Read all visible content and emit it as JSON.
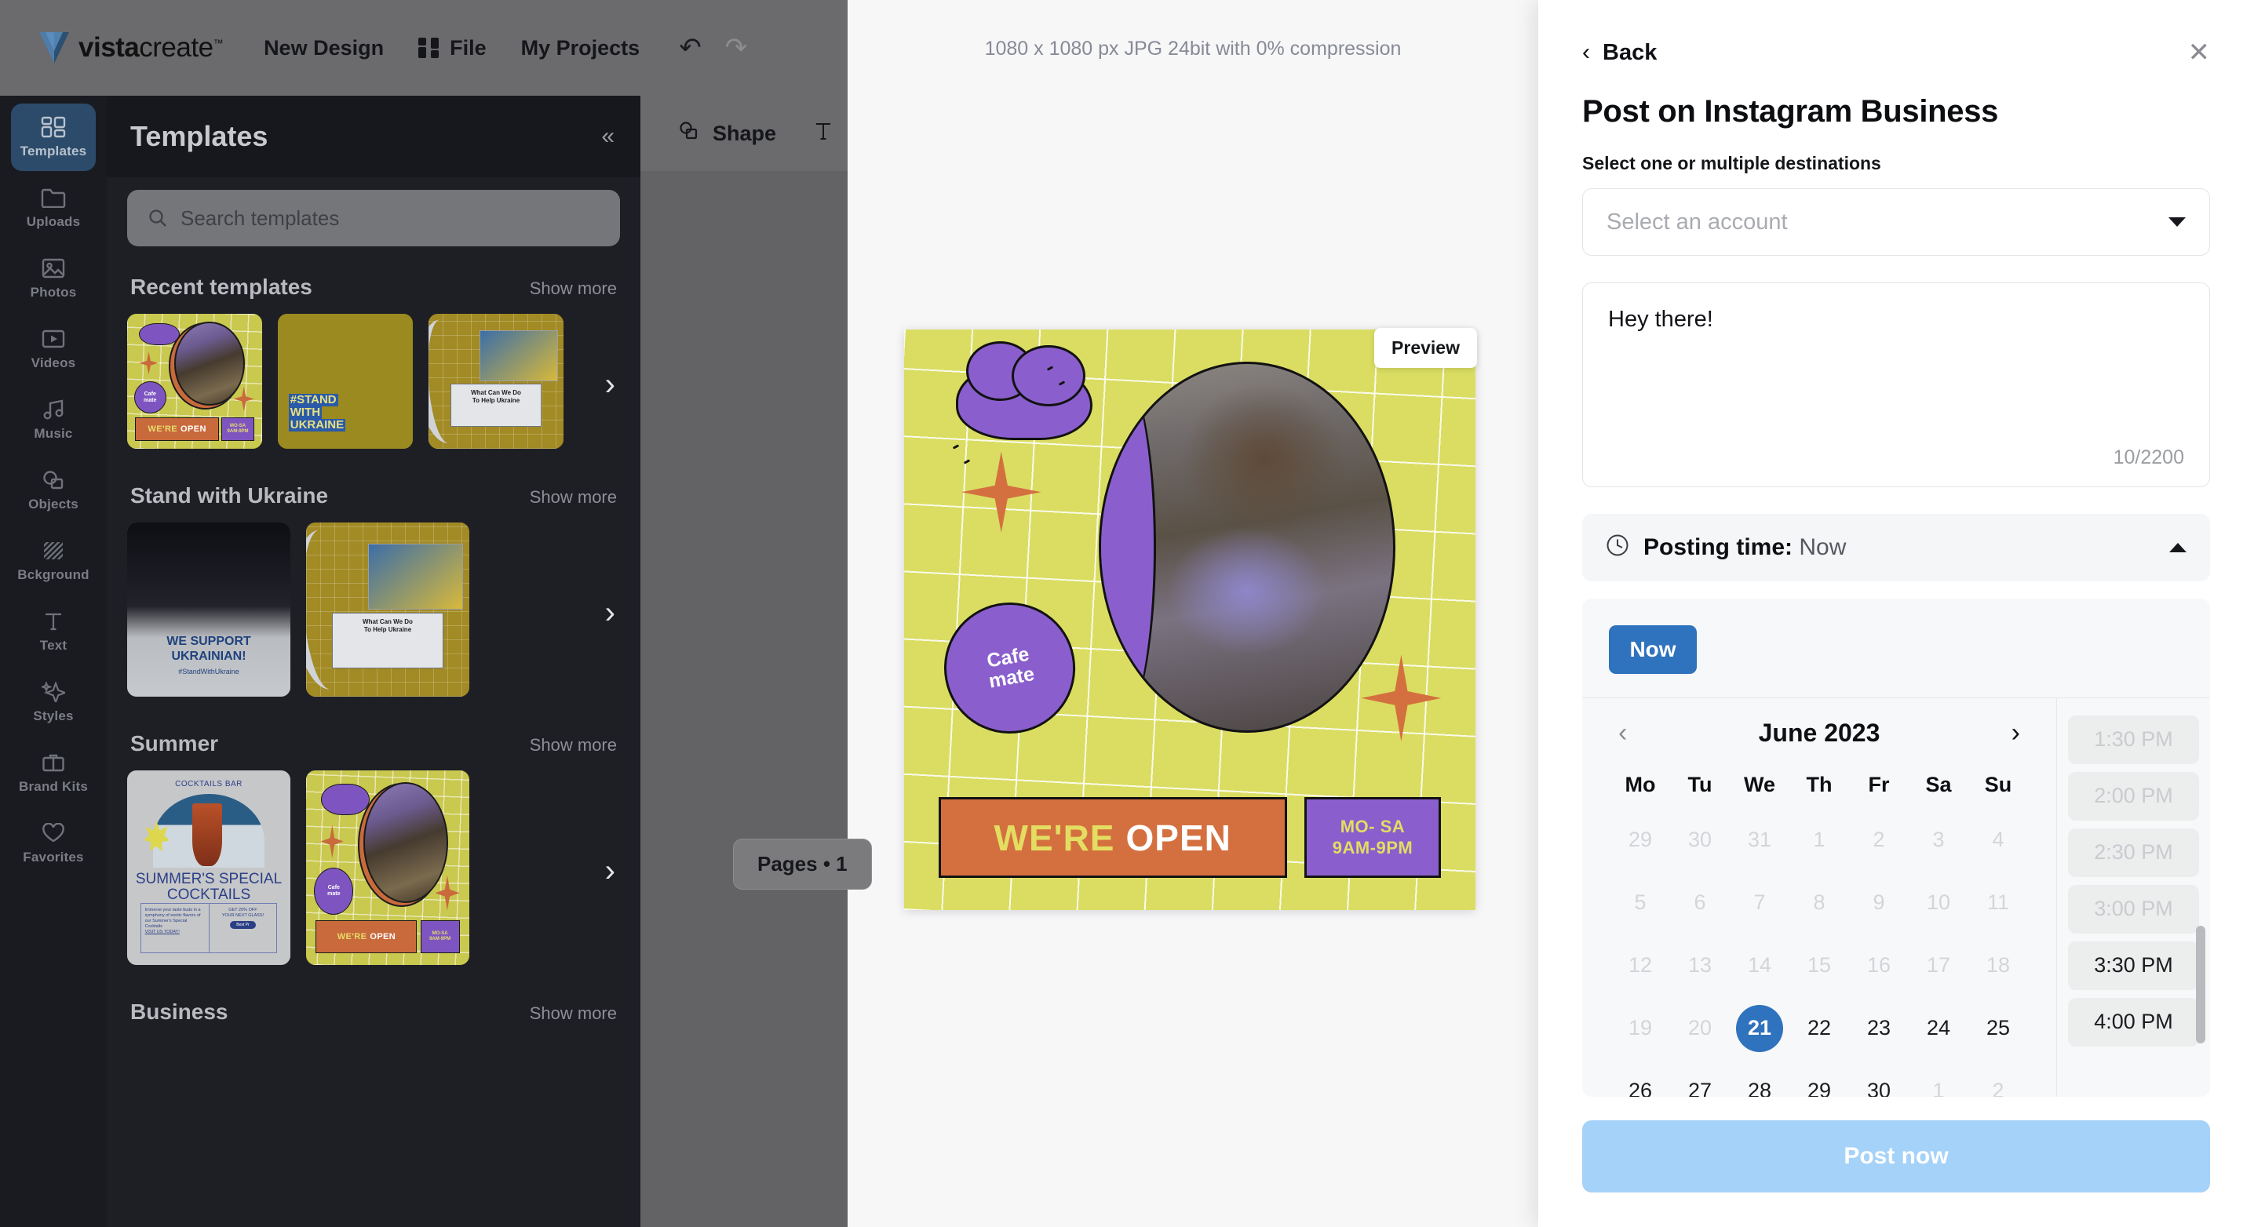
{
  "topbar": {
    "brand_bold": "vista",
    "brand_light": "create",
    "brand_tm": "TM",
    "new_design": "New Design",
    "file": "File",
    "my_projects": "My Projects",
    "undo_icon": "undo-arrow",
    "redo_icon": "redo-arrow"
  },
  "rail": {
    "items": [
      {
        "label": "Templates",
        "icon": "templates-grid-icon",
        "active": true
      },
      {
        "label": "Uploads",
        "icon": "folder-icon",
        "active": false
      },
      {
        "label": "Photos",
        "icon": "image-icon",
        "active": false
      },
      {
        "label": "Videos",
        "icon": "video-play-icon",
        "active": false
      },
      {
        "label": "Music",
        "icon": "music-note-icon",
        "active": false
      },
      {
        "label": "Objects",
        "icon": "shapes-icon",
        "active": false
      },
      {
        "label": "Bckground",
        "icon": "hatch-square-icon",
        "active": false
      },
      {
        "label": "Text",
        "icon": "text-t-icon",
        "active": false
      },
      {
        "label": "Styles",
        "icon": "sparkle-icon",
        "active": false
      },
      {
        "label": "Brand Kits",
        "icon": "briefcase-icon",
        "active": false
      },
      {
        "label": "Favorites",
        "icon": "heart-icon",
        "active": false
      }
    ]
  },
  "panel": {
    "title": "Templates",
    "collapse_icon": "collapse-left-icon",
    "search_placeholder": "Search templates",
    "search_icon": "search-icon",
    "sections": [
      {
        "title": "Recent templates",
        "more": "Show more"
      },
      {
        "title": "Stand with Ukraine",
        "more": "Show more"
      },
      {
        "title": "Summer",
        "more": "Show more"
      },
      {
        "title": "Business",
        "more": "Show more"
      }
    ],
    "thumb_texts": {
      "open_bubble": "Cafe\nmate",
      "open_band": "WE'RE",
      "open_band_b": "OPEN",
      "open_hours_1": "MO- SA",
      "open_hours_2": "9AM-9PM",
      "swu_l1": "#STAND",
      "swu_l2": "WITH",
      "swu_l3": "UKRAINE",
      "ukr_window": "What Can We Do To Help Ukraine",
      "support_main": "WE SUPPORT UKRAINIAN!",
      "support_sub": "#StandWithUkraine",
      "cocktail_kicker": "COCKTAILS BAR",
      "cocktail_title": "SUMMER'S SPECIAL COCKTAILS",
      "cocktail_body": "Immerse your taste buds in a symphony of exotic flavors of our Summer's Special Cocktails",
      "cocktail_link": "VISIT US TODAY!",
      "cocktail_offer": "GET 20% OFF YOUR NEXT GLASS!",
      "cocktail_btn": "Best Pr"
    },
    "next_arrow_icon": "chevron-right-icon"
  },
  "toolbar": {
    "shape": "Shape",
    "shape_icon": "shapes-icon",
    "text_icon": "text-t-icon"
  },
  "canvas": {
    "export_note": "1080 x 1080 px JPG 24bit with 0% compression",
    "preview_tag": "Preview",
    "pages": "Pages • 1",
    "design": {
      "bubble": "Cafe\nmate",
      "band_1": "WE'RE",
      "band_2": "OPEN",
      "hours_1": "MO- SA",
      "hours_2": "9AM-9PM"
    }
  },
  "modal": {
    "back": "Back",
    "back_icon": "chevron-left-icon",
    "close_icon": "close-icon",
    "title": "Post on Instagram Business",
    "destinations_label": "Select one or multiple destinations",
    "account_placeholder": "Select an account",
    "account_caret_icon": "chevron-down-icon",
    "caption_value": "Hey there!",
    "char_count": "10/2200",
    "posting_time_label": "Posting time:",
    "posting_time_value": "Now",
    "clock_icon": "clock-icon",
    "collapse_caret_icon": "chevron-up-icon",
    "now_button": "Now",
    "post_button": "Post now",
    "calendar": {
      "prev_icon": "chevron-left-icon",
      "next_icon": "chevron-right-icon",
      "month": "June 2023",
      "dow": [
        "Mo",
        "Tu",
        "We",
        "Th",
        "Fr",
        "Sa",
        "Su"
      ],
      "weeks": [
        [
          {
            "d": "29",
            "mute": true
          },
          {
            "d": "30",
            "mute": true
          },
          {
            "d": "31",
            "mute": true
          },
          {
            "d": "1",
            "mute": true
          },
          {
            "d": "2",
            "mute": true
          },
          {
            "d": "3",
            "mute": true
          },
          {
            "d": "4",
            "mute": true
          }
        ],
        [
          {
            "d": "5",
            "mute": true
          },
          {
            "d": "6",
            "mute": true
          },
          {
            "d": "7",
            "mute": true
          },
          {
            "d": "8",
            "mute": true
          },
          {
            "d": "9",
            "mute": true
          },
          {
            "d": "10",
            "mute": true
          },
          {
            "d": "11",
            "mute": true
          }
        ],
        [
          {
            "d": "12",
            "mute": true
          },
          {
            "d": "13",
            "mute": true
          },
          {
            "d": "14",
            "mute": true
          },
          {
            "d": "15",
            "mute": true
          },
          {
            "d": "16",
            "mute": true
          },
          {
            "d": "17",
            "mute": true
          },
          {
            "d": "18",
            "mute": true
          }
        ],
        [
          {
            "d": "19",
            "mute": true
          },
          {
            "d": "20",
            "mute": true
          },
          {
            "d": "21",
            "sel": true
          },
          {
            "d": "22"
          },
          {
            "d": "23"
          },
          {
            "d": "24"
          },
          {
            "d": "25"
          }
        ],
        [
          {
            "d": "26"
          },
          {
            "d": "27"
          },
          {
            "d": "28"
          },
          {
            "d": "29"
          },
          {
            "d": "30"
          },
          {
            "d": "1",
            "mute": true
          },
          {
            "d": "2",
            "mute": true
          }
        ]
      ]
    },
    "times": [
      {
        "t": "1:30 PM",
        "dim": true
      },
      {
        "t": "2:00 PM",
        "dim": true
      },
      {
        "t": "2:30 PM",
        "dim": true
      },
      {
        "t": "3:00 PM",
        "dim": true
      },
      {
        "t": "3:30 PM",
        "dim": false
      },
      {
        "t": "4:00 PM",
        "dim": false
      }
    ]
  },
  "colors": {
    "accent_blue": "#2f72bd",
    "post_button": "#a5d2f8",
    "rail_active": "#2c4b6b",
    "design_bg": "#dadd62",
    "design_purple": "#8a5fcd",
    "design_orange": "#d4703f"
  }
}
